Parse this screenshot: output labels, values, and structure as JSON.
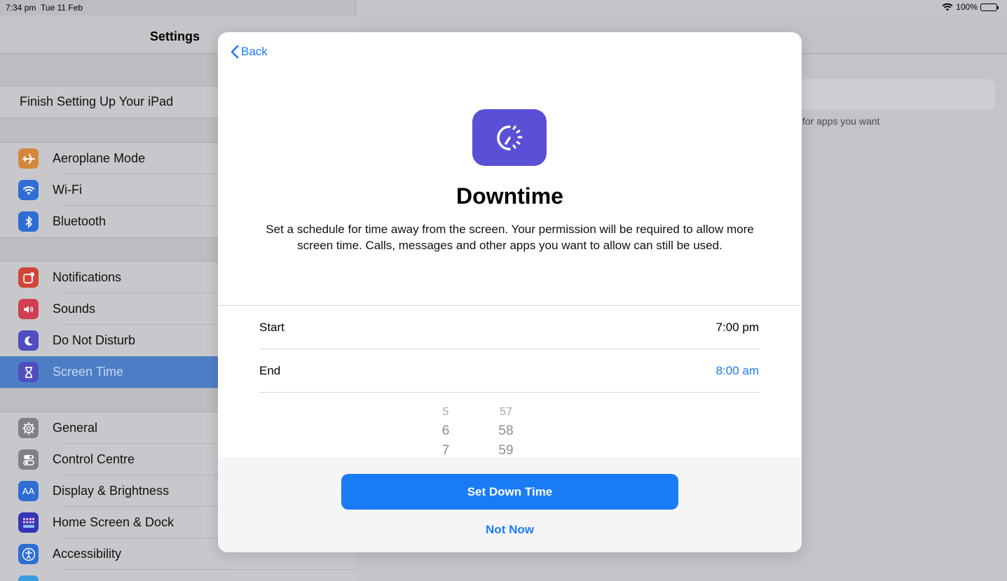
{
  "status_bar": {
    "time": "7:34 pm",
    "date": "Tue 11 Feb",
    "battery": "100%"
  },
  "sidebar": {
    "title": "Settings",
    "finish_setup": "Finish Setting Up Your iPad",
    "groups": [
      [
        {
          "label": "Aeroplane Mode",
          "icon": "airplane-icon",
          "color": "#f09a37"
        },
        {
          "label": "Wi-Fi",
          "icon": "wifi-icon",
          "color": "#3478f6"
        },
        {
          "label": "Bluetooth",
          "icon": "bluetooth-icon",
          "color": "#3478f6"
        }
      ],
      [
        {
          "label": "Notifications",
          "icon": "notifications-icon",
          "color": "#eb4d3d"
        },
        {
          "label": "Sounds",
          "icon": "speaker-icon",
          "color": "#eb445a"
        },
        {
          "label": "Do Not Disturb",
          "icon": "moon-icon",
          "color": "#5856d6"
        },
        {
          "label": "Screen Time",
          "icon": "hourglass-icon",
          "color": "#5856d6",
          "selected": true
        }
      ],
      [
        {
          "label": "General",
          "icon": "gear-icon",
          "color": "#8e8e93"
        },
        {
          "label": "Control Centre",
          "icon": "toggles-icon",
          "color": "#8e8e93"
        },
        {
          "label": "Display & Brightness",
          "icon": "text-size-icon",
          "color": "#3478f6"
        },
        {
          "label": "Home Screen & Dock",
          "icon": "home-grid-icon",
          "color": "#3a3ad0"
        },
        {
          "label": "Accessibility",
          "icon": "accessibility-icon",
          "color": "#3478f6"
        }
      ]
    ]
  },
  "background_detail": {
    "note": "its for apps you want"
  },
  "modal": {
    "back_label": "Back",
    "title": "Downtime",
    "description": "Set a schedule for time away from the screen. Your permission will be required to allow more screen time. Calls, messages and other apps you want to allow can still be used.",
    "start_label": "Start",
    "start_value": "7:00 pm",
    "end_label": "End",
    "end_value": "8:00 am",
    "picker": {
      "hours": [
        "5",
        "6",
        "7"
      ],
      "minutes": [
        "57",
        "58",
        "59"
      ]
    },
    "primary_button": "Set Down Time",
    "secondary_button": "Not Now"
  },
  "colors": {
    "accent": "#1a7cf5",
    "downtime_icon": "#5b4fd6"
  }
}
